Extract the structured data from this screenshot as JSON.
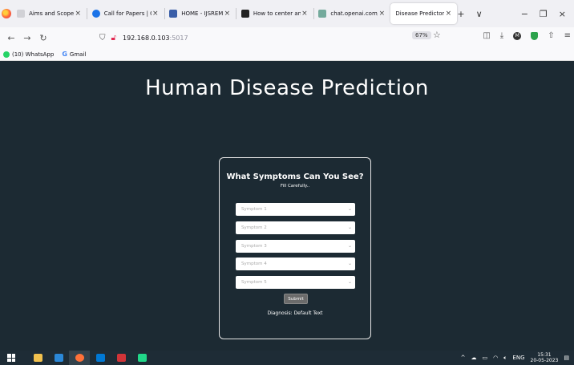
{
  "browser": {
    "tabs": [
      {
        "title": "Aims and Scope",
        "icon": "tab-favicon",
        "color": "#d1d1d6"
      },
      {
        "title": "Call for Papers | Online",
        "icon": "tab-favicon",
        "color": "#1b73e8"
      },
      {
        "title": "HOME - IJSREM",
        "icon": "tab-favicon",
        "color": "#3a5ea8"
      },
      {
        "title": "How to center an item",
        "icon": "tab-favicon",
        "color": "#222222"
      },
      {
        "title": "chat.openai.com/",
        "icon": "tab-favicon",
        "color": "#74aa9c"
      },
      {
        "title": "Disease Predictor",
        "icon": "tab-favicon",
        "color": "#ffffff"
      }
    ],
    "close_glyph": "×",
    "new_tab_glyph": "+",
    "tab_list_glyph": "∨",
    "minimize_glyph": "−",
    "restore_glyph": "❐",
    "window_close_glyph": "×",
    "url_host": "192.168.0.103",
    "url_port": ":5017",
    "zoom": "67%",
    "bookmarks": [
      {
        "label": "(10) WhatsApp"
      },
      {
        "label": "Gmail"
      }
    ]
  },
  "page": {
    "title": "Human Disease Prediction",
    "form": {
      "heading": "What Symptoms Can You See?",
      "subheading": "Fill Carefully..",
      "selects": [
        {
          "placeholder": "Symptom 1"
        },
        {
          "placeholder": "Symptom 2"
        },
        {
          "placeholder": "Symptom 3"
        },
        {
          "placeholder": "Symptom 4"
        },
        {
          "placeholder": "Symptom 5"
        }
      ],
      "submit_label": "Submit",
      "diagnosis": "Diagnosis: Default Text"
    }
  },
  "taskbar": {
    "language": "ENG",
    "time": "15:31",
    "date": "20-05-2023"
  },
  "colors": {
    "page_background": "#1c2a33",
    "card_border": "#e6e6e6",
    "submit_background": "#6b6b6b"
  }
}
